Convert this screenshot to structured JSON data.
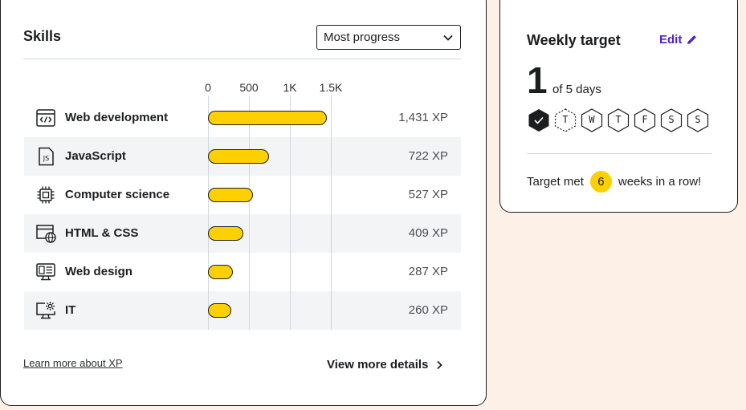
{
  "skills": {
    "title": "Skills",
    "sort_value": "Most progress",
    "axis_ticks": [
      "0",
      "500",
      "1K",
      "1.5K"
    ],
    "items": [
      {
        "name": "Web development",
        "xp": "1,431 XP",
        "icon": "code-icon",
        "value": 1431
      },
      {
        "name": "JavaScript",
        "xp": "722 XP",
        "icon": "js-file-icon",
        "value": 722
      },
      {
        "name": "Computer science",
        "xp": "527 XP",
        "icon": "chip-icon",
        "value": 527
      },
      {
        "name": "HTML & CSS",
        "xp": "409 XP",
        "icon": "browser-globe-icon",
        "value": 409
      },
      {
        "name": "Web design",
        "xp": "287 XP",
        "icon": "design-monitor-icon",
        "value": 287
      },
      {
        "name": "IT",
        "xp": "260 XP",
        "icon": "monitor-gear-icon",
        "value": 260
      }
    ],
    "learn_link": "Learn more about XP",
    "details_link": "View more details"
  },
  "weekly": {
    "title": "Weekly target",
    "edit_label": "Edit",
    "current": "1",
    "of_label": "of 5 days",
    "days": [
      {
        "label": "",
        "state": "done"
      },
      {
        "label": "T",
        "state": "today"
      },
      {
        "label": "W",
        "state": "pending"
      },
      {
        "label": "T",
        "state": "pending"
      },
      {
        "label": "F",
        "state": "pending"
      },
      {
        "label": "S",
        "state": "pending"
      },
      {
        "label": "S",
        "state": "pending"
      }
    ],
    "streak_prefix": "Target met",
    "streak_count": "6",
    "streak_suffix": "weeks in a row!"
  },
  "colors": {
    "accent": "#ffd000",
    "link": "#5022c3",
    "ink": "#1c1d1f",
    "page_bg": "#fdf0e6"
  }
}
